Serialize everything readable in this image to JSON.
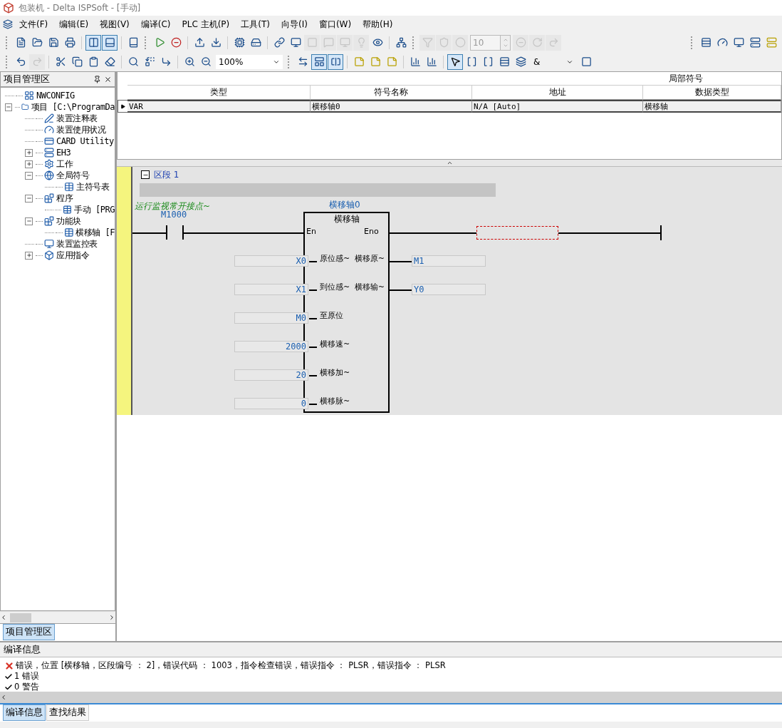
{
  "window": {
    "title": "包装机 - Delta ISPSoft - [手动]"
  },
  "menu": [
    {
      "label": "文件(F)"
    },
    {
      "label": "编辑(E)"
    },
    {
      "label": "视图(V)"
    },
    {
      "label": "编译(C)"
    },
    {
      "label": "PLC 主机(P)"
    },
    {
      "label": "工具(T)"
    },
    {
      "label": "向导(I)"
    },
    {
      "label": "窗口(W)"
    },
    {
      "label": "帮助(H)"
    }
  ],
  "toolbar_1": [
    {
      "disabled": false,
      "pressed": false
    },
    {
      "disabled": false,
      "pressed": false
    },
    {
      "disabled": false,
      "pressed": false
    },
    {
      "disabled": false,
      "pressed": false
    },
    {
      "disabled": false,
      "pressed": true
    },
    {
      "disabled": false,
      "pressed": true
    },
    {
      "disabled": false,
      "pressed": false
    },
    {
      "disabled": false,
      "pressed": false
    },
    {
      "disabled": false,
      "pressed": false
    },
    {
      "disabled": false,
      "pressed": false
    },
    {
      "disabled": false,
      "pressed": false
    },
    {
      "disabled": false,
      "pressed": false
    },
    {
      "disabled": false,
      "pressed": false
    },
    {
      "disabled": false,
      "pressed": false
    },
    {
      "disabled": false,
      "pressed": false
    },
    {
      "disabled": true,
      "pressed": false
    },
    {
      "disabled": true,
      "pressed": false
    },
    {
      "disabled": true,
      "pressed": false
    },
    {
      "disabled": true,
      "pressed": false
    },
    {
      "disabled": false,
      "pressed": false
    },
    {
      "disabled": false,
      "pressed": false
    },
    {
      "disabled": true,
      "pressed": false
    },
    {
      "disabled": true,
      "pressed": false
    },
    {
      "disabled": true,
      "pressed": false
    }
  ],
  "spin_value": "10",
  "toolbar_1_tail": [
    {
      "disabled": true
    },
    {
      "disabled": true
    },
    {
      "disabled": true
    }
  ],
  "toolbar_2": [
    {
      "disabled": false,
      "pressed": false
    },
    {
      "disabled": true,
      "pressed": false
    },
    {
      "disabled": false,
      "pressed": false
    },
    {
      "disabled": false,
      "pressed": false
    },
    {
      "disabled": false,
      "pressed": false
    },
    {
      "disabled": false,
      "pressed": false
    },
    {
      "disabled": false,
      "pressed": false
    },
    {
      "disabled": false,
      "pressed": false
    },
    {
      "disabled": false,
      "pressed": false
    },
    {
      "disabled": false,
      "pressed": false
    },
    {
      "disabled": false,
      "pressed": false
    }
  ],
  "zoom": "100%",
  "toolbar_2b": [
    {
      "disabled": false,
      "pressed": false
    },
    {
      "disabled": false,
      "pressed": true
    },
    {
      "disabled": false,
      "pressed": true
    },
    {
      "disabled": false,
      "pressed": false
    },
    {
      "disabled": false,
      "pressed": false
    },
    {
      "disabled": false,
      "pressed": false
    },
    {
      "disabled": false,
      "pressed": false
    },
    {
      "disabled": false,
      "pressed": false
    },
    {
      "disabled": false,
      "pressed": true
    },
    {
      "disabled": false,
      "pressed": false
    },
    {
      "disabled": false,
      "pressed": false
    },
    {
      "disabled": false,
      "pressed": false
    },
    {
      "disabled": false,
      "pressed": false
    }
  ],
  "logic_op": "&",
  "project_panel": {
    "title": "项目管理区",
    "tree": [
      {
        "label": "NWCONFIG"
      },
      {
        "label": "项目 [C:\\ProgramDa",
        "expanded": true,
        "children": [
          {
            "label": "装置注释表"
          },
          {
            "label": "装置使用状况"
          },
          {
            "label": "CARD Utility"
          },
          {
            "label": "EH3",
            "expanded": false
          },
          {
            "label": "工作",
            "expanded": false
          },
          {
            "label": "全局符号",
            "expanded": true,
            "children": [
              {
                "label": "主符号表"
              }
            ]
          },
          {
            "label": "程序",
            "expanded": true,
            "children": [
              {
                "label": "手动 [PRG"
              }
            ]
          },
          {
            "label": "功能块",
            "expanded": true,
            "children": [
              {
                "label": "横移轴 [F"
              }
            ]
          },
          {
            "label": "装置监控表"
          },
          {
            "label": "应用指令",
            "expanded": false
          }
        ]
      }
    ],
    "tab": "项目管理区"
  },
  "symbol_table": {
    "group_header": "局部符号",
    "columns": [
      "类型",
      "符号名称",
      "地址",
      "数据类型"
    ],
    "rows": [
      [
        "VAR",
        "横移轴0",
        "N/A [Auto]",
        "横移轴"
      ]
    ]
  },
  "ladder": {
    "segment": "区段 1",
    "expanded": true,
    "comment": "运行监视常开接点~",
    "contact": "M1000",
    "fb": {
      "instance": "横移轴0",
      "type": "横移轴",
      "en": "En",
      "eno": "Eno",
      "inputs": [
        {
          "pin": "原位感~",
          "value": "X0"
        },
        {
          "pin": "到位感~",
          "value": "X1"
        },
        {
          "pin": "至原位",
          "value": "M0"
        },
        {
          "pin": "横移速~",
          "value": "2000"
        },
        {
          "pin": "横移加~",
          "value": "20"
        },
        {
          "pin": "横移脉~",
          "value": "0"
        }
      ],
      "outputs": [
        {
          "pin": "横移原~",
          "value": "M1"
        },
        {
          "pin": "横移输~",
          "value": "Y0"
        }
      ]
    }
  },
  "compile_panel": {
    "title": "编译信息",
    "messages": [
      {
        "kind": "error",
        "text": "错误，位置 [横移轴，区段编号 ： 2]，错误代码 ： 1003，指令检查错误，错误指令 ： PLSR，错误指令 ： PLSR"
      },
      {
        "kind": "ok",
        "text": "1 错误"
      },
      {
        "kind": "ok",
        "text": "0 警告"
      }
    ],
    "tabs": [
      {
        "label": "编译信息",
        "selected": true
      },
      {
        "label": "查找结果",
        "selected": false
      }
    ]
  }
}
